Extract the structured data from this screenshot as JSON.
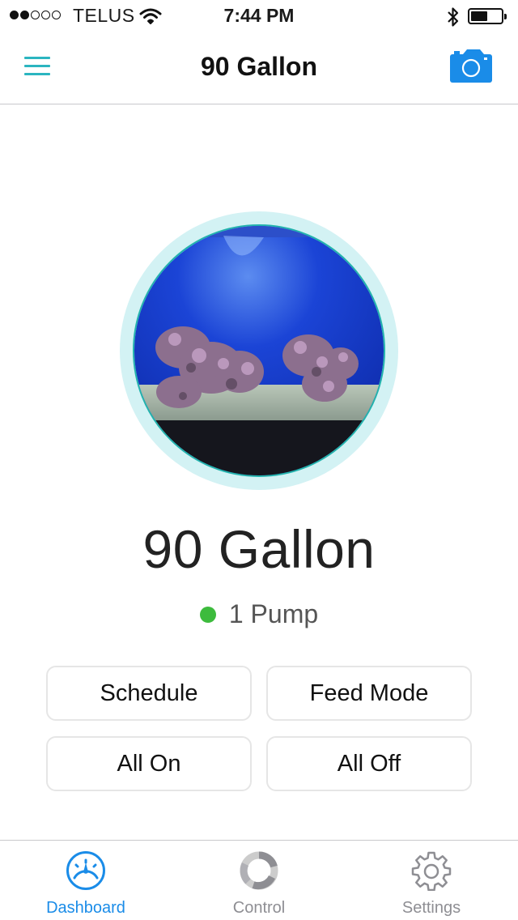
{
  "status_bar": {
    "signal_dots_filled": 2,
    "signal_dots_total": 5,
    "carrier": "TELUS",
    "time": "7:44 PM",
    "battery_level": 0.55
  },
  "nav_bar": {
    "title": "90 Gallon",
    "menu_icon": "hamburger-menu-icon",
    "camera_icon": "camera-icon",
    "accent_color": "#2bb5c0",
    "camera_color": "#1a8ce8"
  },
  "tank": {
    "name": "90 Gallon",
    "pump_status": "1 Pump",
    "status_color": "#3dbb3d"
  },
  "actions": {
    "schedule": "Schedule",
    "feed_mode": "Feed Mode",
    "all_on": "All On",
    "all_off": "All Off"
  },
  "tabs": [
    {
      "label": "Dashboard",
      "icon": "dashboard-gauge-icon",
      "active": true
    },
    {
      "label": "Control",
      "icon": "control-ring-icon",
      "active": false
    },
    {
      "label": "Settings",
      "icon": "gear-icon",
      "active": false
    }
  ],
  "colors": {
    "active_tab": "#1a8ce8",
    "inactive_tab": "#8e8e93"
  }
}
